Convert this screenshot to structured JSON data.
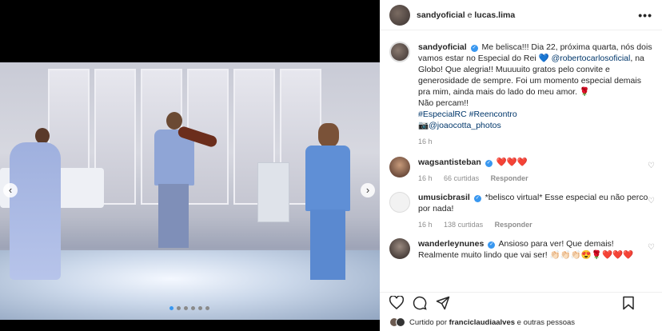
{
  "post_header": {
    "user1": "sandyoficial",
    "connector": "e",
    "user2": "lucas.lima",
    "more": "•••"
  },
  "caption": {
    "user": "sandyoficial",
    "text1": "Me belisca!!! Dia 22, próxima quarta, nós dois vamos estar no Especial do Rei 💙",
    "mention1": "@robertocarlosoficial",
    "text2": ", na Globo! Que alegria!! Muuuuito gratos pelo convite e generosidade de sempre. Foi um momento especial demais pra mim, ainda mais do lado do meu amor. 🌹",
    "text3": "Não percam!!",
    "hashtags": "#EspecialRC #Reencontro",
    "credit_prefix": "📷",
    "credit": "@joaocotta_photos",
    "time": "16 h"
  },
  "comments": [
    {
      "user": "wagsantisteban",
      "verified": true,
      "text": "❤️❤️❤️",
      "time": "16 h",
      "likes": "66 curtidas",
      "reply": "Responder"
    },
    {
      "user": "umusicbrasil",
      "verified": true,
      "text": "*belisco virtual* Esse especial eu não perco por nada!",
      "time": "16 h",
      "likes": "138 curtidas",
      "reply": "Responder"
    },
    {
      "user": "wanderleynunes",
      "verified": true,
      "text": "Ansioso para ver! Que demais! Realmente muito lindo que vai ser! 👏🏻👏🏻👏🏻😍🌹❤️❤️❤️",
      "time": "",
      "likes": "",
      "reply": ""
    }
  ],
  "liked_by": {
    "prefix": "Curtido por",
    "user": "franciclaudiaalves",
    "suffix": "e outras pessoas"
  },
  "carousel": {
    "prev": "‹",
    "next": "›",
    "dots": 6,
    "active": 0
  },
  "icons": {
    "heart": "heart-icon",
    "comment": "comment-icon",
    "share": "share-icon",
    "save": "bookmark-icon"
  },
  "colors": {
    "verified": "#3897f0",
    "link": "#00376b",
    "muted": "#8e8e8e"
  }
}
